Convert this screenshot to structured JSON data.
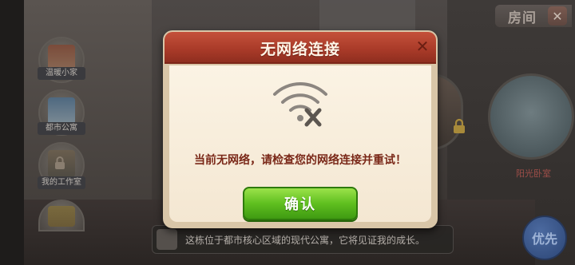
{
  "room_panel": {
    "title": "房间",
    "close_glyph": "✕",
    "rooms": [
      {
        "label": "阳光卧室"
      }
    ]
  },
  "sidebar": {
    "items": [
      {
        "label": "温暖小家"
      },
      {
        "label": "都市公寓"
      },
      {
        "label": "我的工作室"
      },
      {
        "label": ""
      }
    ]
  },
  "description": {
    "text": "这栋位于都市核心区域的现代公寓，它将见证我的成长。"
  },
  "priority_button": {
    "label": "优先"
  },
  "dialog": {
    "title": "无网络连接",
    "close_glyph": "✕",
    "message": "当前无网络，请检查您的网络连接并重试！",
    "confirm_label": "确认",
    "icon": "wifi-off-icon"
  },
  "colors": {
    "dialog_header": "#b3412d",
    "dialog_body": "#fbf3e4",
    "confirm_button": "#5fbf1f",
    "message_text": "#7a2818"
  }
}
